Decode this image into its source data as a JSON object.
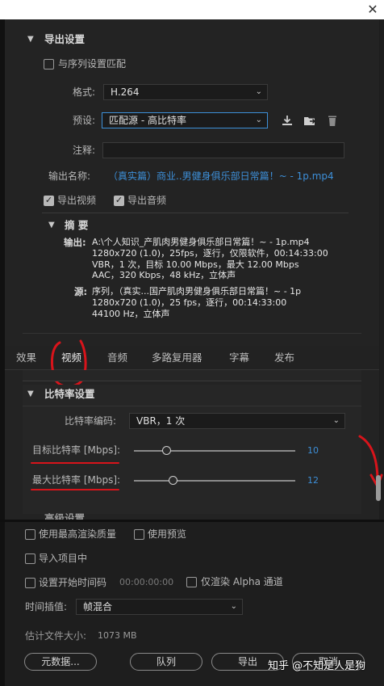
{
  "export_settings": {
    "title": "导出设置",
    "match_sequence_label": "与序列设置匹配",
    "format_label": "格式:",
    "format_value": "H.264",
    "preset_label": "预设:",
    "preset_value": "匹配源 - 高比特率",
    "comments_label": "注释:",
    "comments_value": "",
    "output_name_label": "输出名称:",
    "output_name_value": "（真实篇）商业..男健身俱乐部日常篇！~ - 1p.mp4",
    "export_video_label": "导出视频",
    "export_audio_label": "导出音频",
    "export_video_checked": true,
    "export_audio_checked": true,
    "match_sequence_checked": false
  },
  "summary": {
    "title": "摘 要",
    "output_label": "输出:",
    "output_lines": [
      "A:\\个人知识_产肌肉男健身俱乐部日常篇！~ - 1p.mp4",
      "1280x720 (1.0)，25fps，逐行，仅限软件，00:14:33:00",
      "VBR，1 次，目标 10.00 Mbps，最大 12.00 Mbps",
      "AAC，320 Kbps，48 kHz，立体声"
    ],
    "source_label": "源:",
    "source_lines": [
      "序列，（真实...国产肌肉男健身俱乐部日常篇！~ - 1p",
      "1280x720 (1.0)，25 fps，逐行，00:14:33:00",
      "44100 Hz，立体声"
    ]
  },
  "tabs": [
    {
      "label": "效果"
    },
    {
      "label": "视频"
    },
    {
      "label": "音频"
    },
    {
      "label": "多路复用器"
    },
    {
      "label": "字幕"
    },
    {
      "label": "发布"
    }
  ],
  "active_tab": "视频",
  "bitrate": {
    "title": "比特率设置",
    "encoding_label": "比特率编码:",
    "encoding_value": "VBR，1 次",
    "target_label": "目标比特率 [Mbps]:",
    "target_value": "10",
    "target_fraction": 0.2,
    "max_label": "最大比特率 [Mbps]:",
    "max_value": "12",
    "max_fraction": 0.24,
    "next_section_partial": "高级设置"
  },
  "bottom": {
    "max_render_quality_label": "使用最高渲染质量",
    "use_previews_label": "使用预览",
    "import_project_label": "导入项目中",
    "set_start_timecode_label": "设置开始时间码",
    "start_timecode_value": "00:00:00:00",
    "render_alpha_label": "仅渲染 Alpha 通道",
    "time_interpolation_label": "时间插值:",
    "time_interpolation_value": "帧混合",
    "estimated_size_label": "估计文件大小:",
    "estimated_size_value": "1073 MB",
    "metadata_button": "元数据...",
    "queue_button": "队列",
    "export_button": "导出",
    "cancel_button": "取消"
  },
  "watermark": "知乎 @不知是人是狗",
  "colors": {
    "accent_blue": "#3d8fd8",
    "annotation_red": "#d8141b"
  }
}
